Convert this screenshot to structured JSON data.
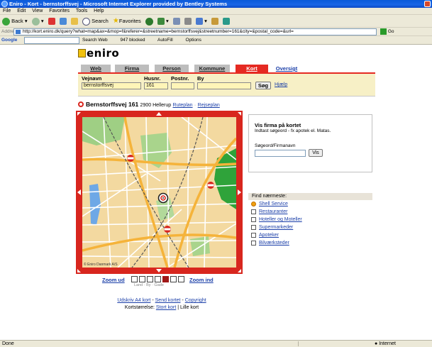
{
  "window": {
    "title": "Eniro - Kort - bernstorffsvej - Microsoft Internet Explorer provided by Bentley Systems"
  },
  "menu": [
    "File",
    "Edit",
    "View",
    "Favorites",
    "Tools",
    "Help"
  ],
  "toolbar": {
    "back_label": "Back",
    "search_label": "Search",
    "favorites_label": "Favorites"
  },
  "address": {
    "label": "Address",
    "url": "http://kort.eniro.dk/query?what=map&ax=&mop=f&referer=&streetname=bernstorffsvej&streetnumber=161&city=&postal_code=&url=",
    "go_label": "Go"
  },
  "google_toolbar": {
    "logo": "Google",
    "search_web": "Search Web",
    "blocked": "947 blocked",
    "autofill": "AutoFill",
    "options": "Options"
  },
  "site": {
    "logo_text": "eniro"
  },
  "tabs": [
    {
      "label": "Web"
    },
    {
      "label": "Firma"
    },
    {
      "label": "Person"
    },
    {
      "label": "Kommune"
    },
    {
      "label": "Kort"
    },
    {
      "label": "Oversigt"
    }
  ],
  "search": {
    "street_label": "Vejnavn",
    "street_value": "bernstorffsvej",
    "number_label": "Husnr.",
    "number_value": "161",
    "postal_label": "Postnr.",
    "postal_value": "",
    "city_label": "By",
    "city_value": "",
    "button_label": "Søg",
    "help_label": "Hjælp"
  },
  "result": {
    "address": "Bernstorffsvej 161",
    "postal": "2900 Hellerup",
    "route_link": "Ruteplan",
    "travel_link": "Rejseplan",
    "link_separator": "·"
  },
  "map": {
    "copyright": "© Eniro Danmark A/S",
    "zoom_out_label": "Zoom ud",
    "zoom_in_label": "Zoom ind",
    "zoom_levels_label": "Land · By · Gade",
    "zoom_level_selected": 5,
    "zoom_level_count": 7
  },
  "footer": {
    "print_link": "Udskriv A4 kort",
    "send_link": "Send kortet",
    "copyright_link": "Copyright",
    "size_label": "Kortstørrelse:",
    "large_map": "Stort kort",
    "small_map": "Lille kort",
    "separator": "-",
    "pipe": "|"
  },
  "find_companies": {
    "heading": "Vis firma på kortet",
    "description": "Indtast søgeord - fx apotek el. Matas.",
    "field_label": "Søgeord/Firmanavn",
    "button_label": "Vis"
  },
  "nearest": {
    "heading": "Find nærmeste:",
    "items": [
      {
        "label": "Shell Service",
        "icon": "shell-icon"
      },
      {
        "label": "Restauranter",
        "icon": "restaurant-icon"
      },
      {
        "label": "Hoteller og Moteller",
        "icon": "hotel-icon"
      },
      {
        "label": "Supermarkeder",
        "icon": "supermarket-icon"
      },
      {
        "label": "Apoteker",
        "icon": "pharmacy-icon"
      },
      {
        "label": "Bilværksteder",
        "icon": "car-repair-icon"
      }
    ]
  },
  "status": {
    "left": "Done",
    "zone": "Internet"
  }
}
